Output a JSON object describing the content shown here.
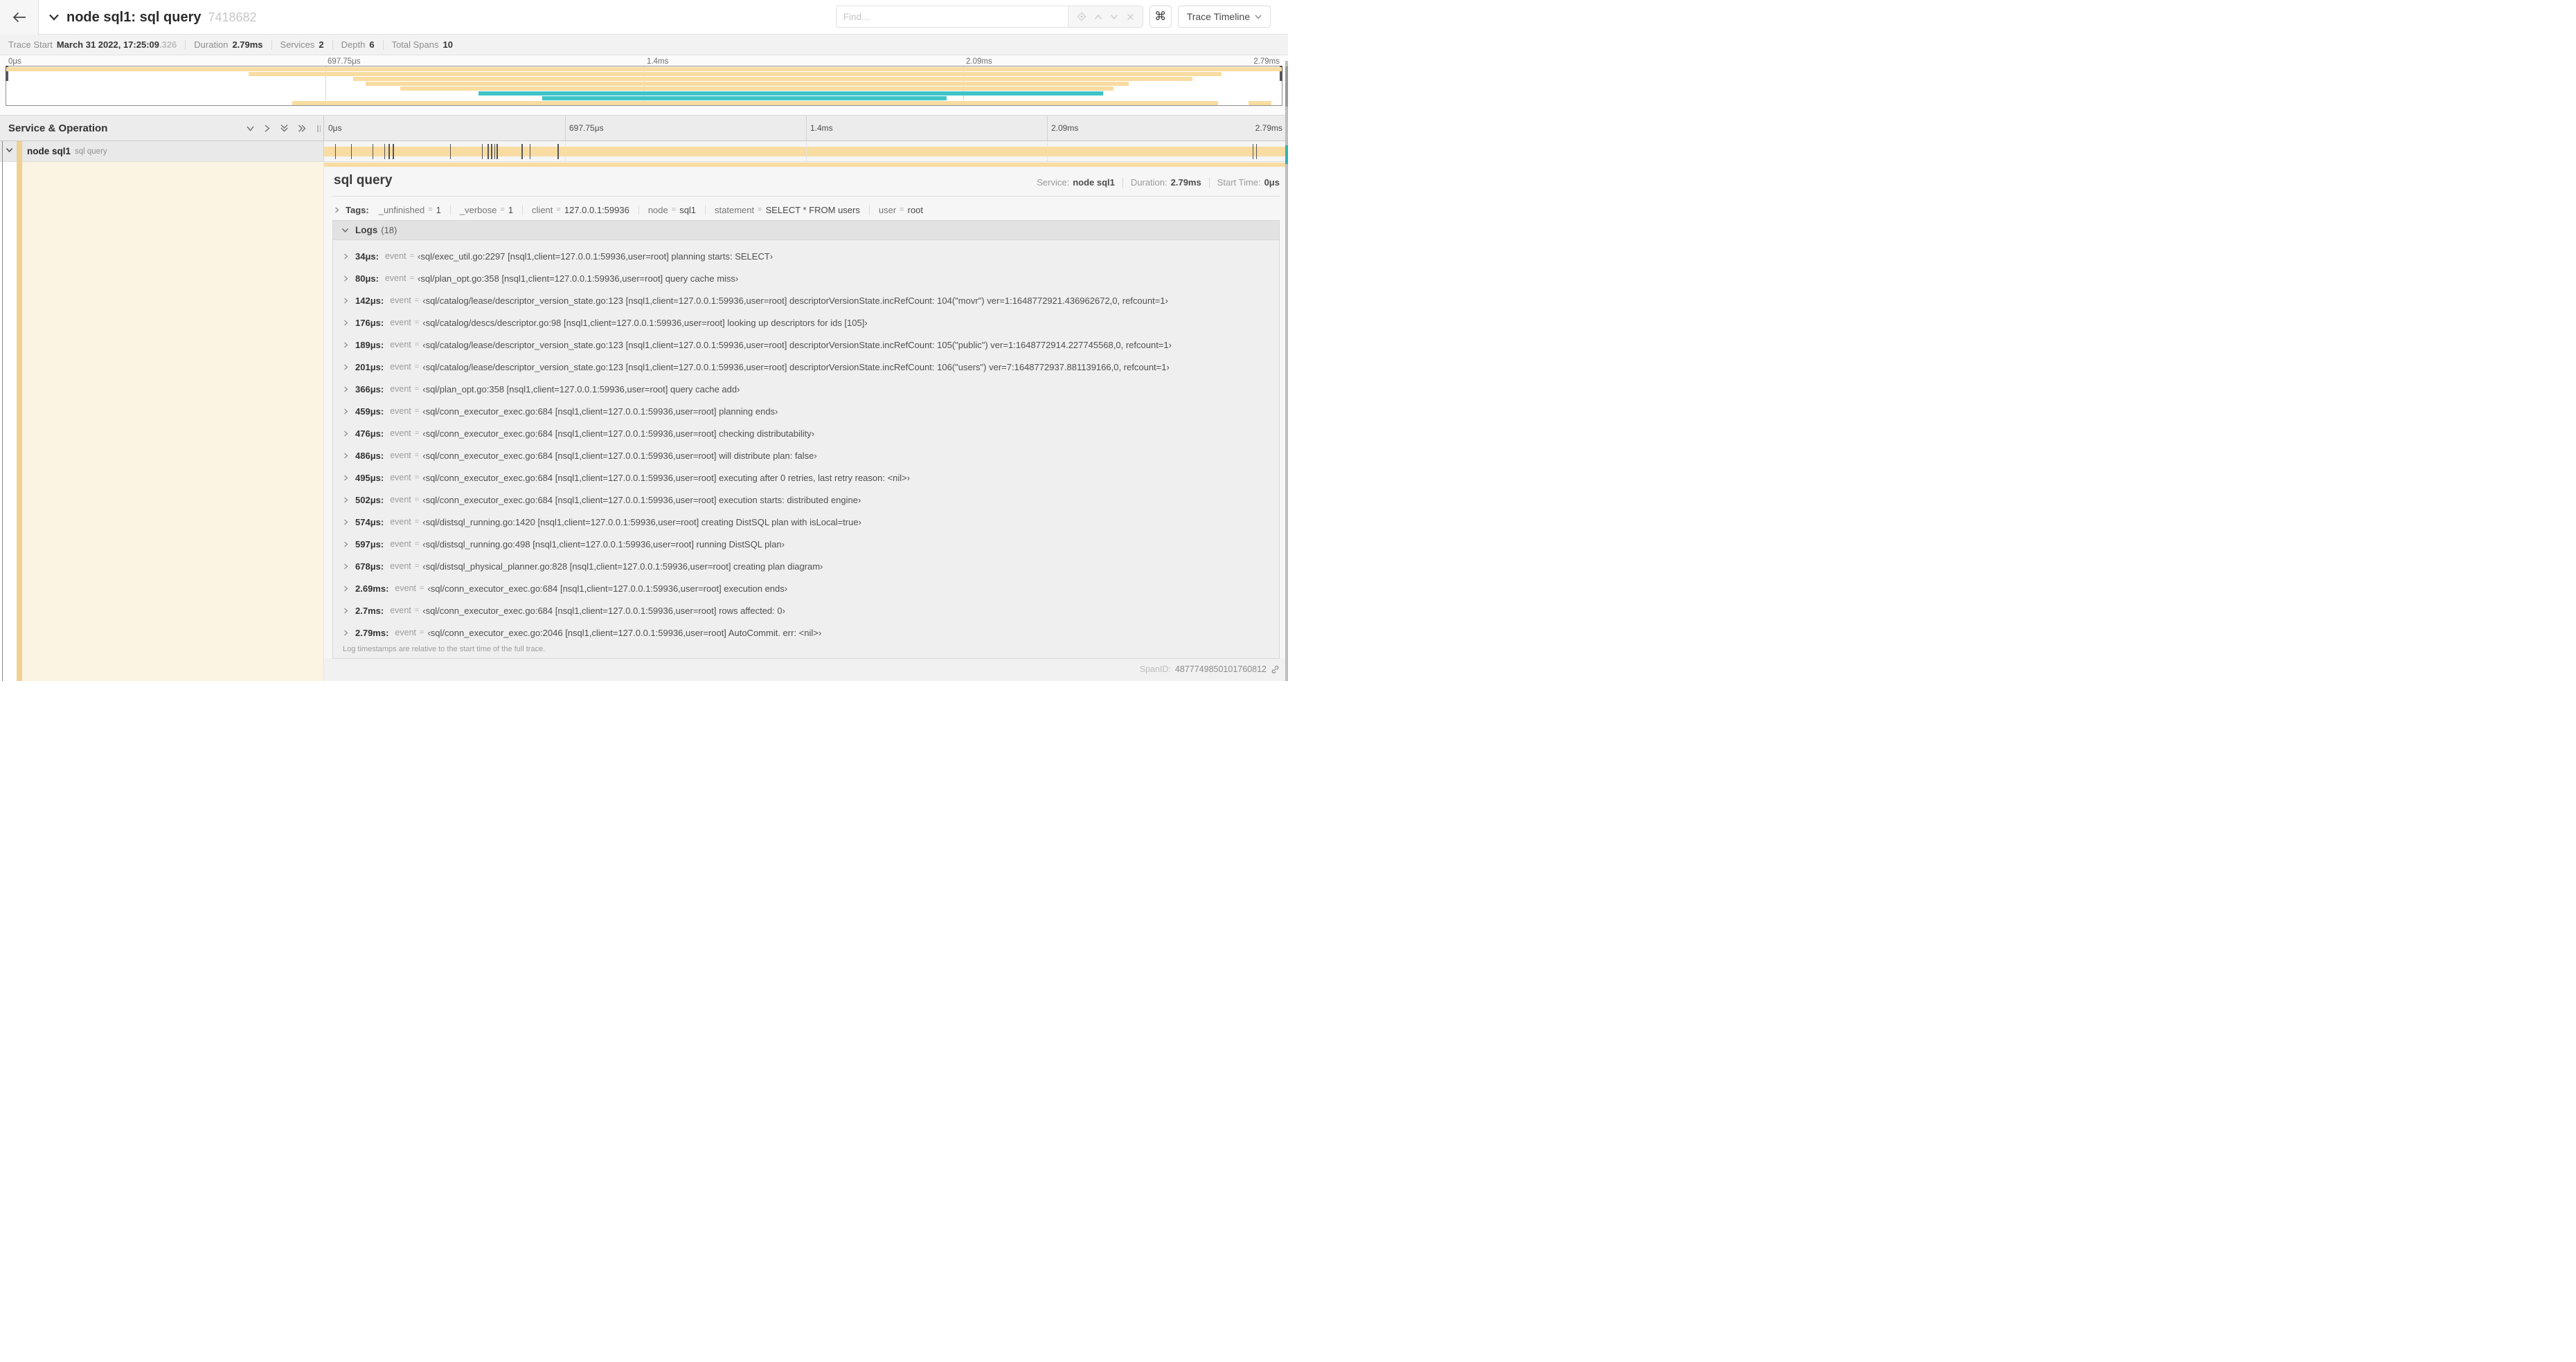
{
  "colors": {
    "tan": "#F8DCA1",
    "teal": "#3EC4C8",
    "stripe": "#EFD193",
    "detail_left_bg": "#FBF4E2"
  },
  "header": {
    "title": "node sql1: sql query",
    "trace_id": "7418682",
    "find_placeholder": "Find...",
    "keyboard_icon": "⌘",
    "view_button": "Trace Timeline"
  },
  "trace_meta": {
    "trace_start_label": "Trace Start",
    "trace_start_value": "March 31 2022, 17:25:09",
    "trace_start_fraction": ".326",
    "duration_label": "Duration",
    "duration_value": "2.79ms",
    "services_label": "Services",
    "services_value": "2",
    "depth_label": "Depth",
    "depth_value": "6",
    "total_spans_label": "Total Spans",
    "total_spans_value": "10"
  },
  "minimap": {
    "ticks": [
      "0μs",
      "697.75μs",
      "1.4ms",
      "2.09ms",
      "2.79ms"
    ],
    "spans": [
      {
        "row": 0,
        "start": 0,
        "end": 100,
        "color": "tan"
      },
      {
        "row": 1,
        "start": 19,
        "end": 95.3,
        "color": "tan"
      },
      {
        "row": 2,
        "start": 27.2,
        "end": 93,
        "color": "tan"
      },
      {
        "row": 3,
        "start": 28.2,
        "end": 88,
        "color": "tan"
      },
      {
        "row": 4,
        "start": 30.9,
        "end": 86.8,
        "color": "tan"
      },
      {
        "row": 5,
        "start": 37,
        "end": 86,
        "color": "teal"
      },
      {
        "row": 6,
        "start": 42,
        "end": 73.7,
        "color": "teal"
      },
      {
        "row": 7,
        "start": 22.4,
        "end": 95,
        "color": "tan"
      },
      {
        "row": 7,
        "start": 97.4,
        "end": 99.2,
        "color": "tan"
      }
    ]
  },
  "timeline": {
    "left_header": "Service & Operation",
    "ticks": [
      "0μs",
      "697.75μs",
      "1.4ms",
      "2.09ms",
      "2.79ms"
    ],
    "duration_us": 2790,
    "row": {
      "service": "node sql1",
      "operation": "sql query",
      "log_marker_times_us": [
        34,
        80,
        142,
        176,
        189,
        201,
        366,
        459,
        476,
        486,
        495,
        502,
        574,
        597,
        678,
        2690,
        2700,
        2790
      ]
    }
  },
  "detail": {
    "title": "sql query",
    "service_label": "Service:",
    "service_value": "node sql1",
    "duration_label": "Duration:",
    "duration_value": "2.79ms",
    "start_label": "Start Time:",
    "start_value": "0μs",
    "tags_label": "Tags:",
    "tags": [
      {
        "key": "_unfinished",
        "value": "1"
      },
      {
        "key": "_verbose",
        "value": "1"
      },
      {
        "key": "client",
        "value": "127.0.0.1:59936"
      },
      {
        "key": "node",
        "value": "sql1"
      },
      {
        "key": "statement",
        "value": "SELECT * FROM users"
      },
      {
        "key": "user",
        "value": "root"
      }
    ],
    "logs_label": "Logs",
    "logs_count": "(18)",
    "log_field": "event",
    "logs": [
      {
        "time": "34μs:",
        "value": "‹sql/exec_util.go:2297 [nsql1,client=127.0.0.1:59936,user=root] planning starts: SELECT›"
      },
      {
        "time": "80μs:",
        "value": "‹sql/plan_opt.go:358 [nsql1,client=127.0.0.1:59936,user=root] query cache miss›"
      },
      {
        "time": "142μs:",
        "value": "‹sql/catalog/lease/descriptor_version_state.go:123 [nsql1,client=127.0.0.1:59936,user=root] descriptorVersionState.incRefCount: 104(\"movr\") ver=1:1648772921.436962672,0, refcount=1›"
      },
      {
        "time": "176μs:",
        "value": "‹sql/catalog/descs/descriptor.go:98 [nsql1,client=127.0.0.1:59936,user=root] looking up descriptors for ids [105]›"
      },
      {
        "time": "189μs:",
        "value": "‹sql/catalog/lease/descriptor_version_state.go:123 [nsql1,client=127.0.0.1:59936,user=root] descriptorVersionState.incRefCount: 105(\"public\") ver=1:1648772914.227745568,0, refcount=1›"
      },
      {
        "time": "201μs:",
        "value": "‹sql/catalog/lease/descriptor_version_state.go:123 [nsql1,client=127.0.0.1:59936,user=root] descriptorVersionState.incRefCount: 106(\"users\") ver=7:1648772937.881139166,0, refcount=1›"
      },
      {
        "time": "366μs:",
        "value": "‹sql/plan_opt.go:358 [nsql1,client=127.0.0.1:59936,user=root] query cache add›"
      },
      {
        "time": "459μs:",
        "value": "‹sql/conn_executor_exec.go:684 [nsql1,client=127.0.0.1:59936,user=root] planning ends›"
      },
      {
        "time": "476μs:",
        "value": "‹sql/conn_executor_exec.go:684 [nsql1,client=127.0.0.1:59936,user=root] checking distributability›"
      },
      {
        "time": "486μs:",
        "value": "‹sql/conn_executor_exec.go:684 [nsql1,client=127.0.0.1:59936,user=root] will distribute plan: false›"
      },
      {
        "time": "495μs:",
        "value": "‹sql/conn_executor_exec.go:684 [nsql1,client=127.0.0.1:59936,user=root] executing after 0 retries, last retry reason: <nil>›"
      },
      {
        "time": "502μs:",
        "value": "‹sql/conn_executor_exec.go:684 [nsql1,client=127.0.0.1:59936,user=root] execution starts: distributed engine›"
      },
      {
        "time": "574μs:",
        "value": "‹sql/distsql_running.go:1420 [nsql1,client=127.0.0.1:59936,user=root] creating DistSQL plan with isLocal=true›"
      },
      {
        "time": "597μs:",
        "value": "‹sql/distsql_running.go:498 [nsql1,client=127.0.0.1:59936,user=root] running DistSQL plan›"
      },
      {
        "time": "678μs:",
        "value": "‹sql/distsql_physical_planner.go:828 [nsql1,client=127.0.0.1:59936,user=root] creating plan diagram›"
      },
      {
        "time": "2.69ms:",
        "value": "‹sql/conn_executor_exec.go:684 [nsql1,client=127.0.0.1:59936,user=root] execution ends›"
      },
      {
        "time": "2.7ms:",
        "value": "‹sql/conn_executor_exec.go:684 [nsql1,client=127.0.0.1:59936,user=root] rows affected: 0›"
      },
      {
        "time": "2.79ms:",
        "value": "‹sql/conn_executor_exec.go:2046 [nsql1,client=127.0.0.1:59936,user=root] AutoCommit. err: <nil>›"
      }
    ],
    "logs_note": "Log timestamps are relative to the start time of the full trace.",
    "span_id_label": "SpanID:",
    "span_id_value": "4877749850101760812"
  }
}
